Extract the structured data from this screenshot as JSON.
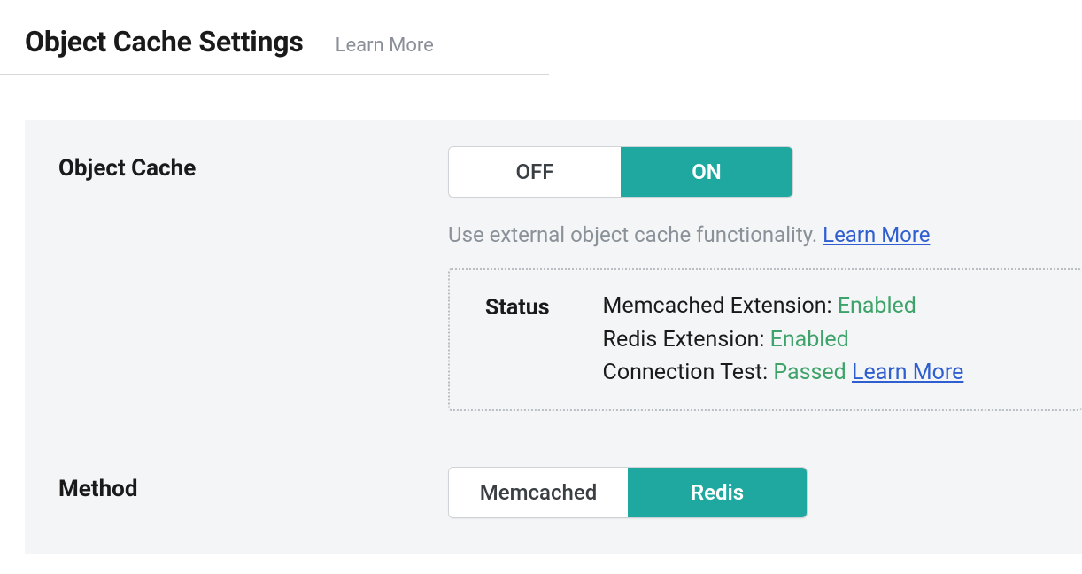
{
  "header": {
    "title": "Object Cache Settings",
    "learn_more": "Learn More"
  },
  "object_cache": {
    "label": "Object Cache",
    "toggle": {
      "off": "OFF",
      "on": "ON",
      "active": "on"
    },
    "hint": "Use external object cache functionality.",
    "hint_link": "Learn More",
    "status": {
      "label": "Status",
      "memcached_label": "Memcached Extension:",
      "memcached_value": "Enabled",
      "redis_label": "Redis Extension:",
      "redis_value": "Enabled",
      "conn_label": "Connection Test:",
      "conn_value": "Passed",
      "conn_link": "Learn More"
    }
  },
  "method": {
    "label": "Method",
    "toggle": {
      "memcached": "Memcached",
      "redis": "Redis",
      "active": "redis"
    }
  }
}
